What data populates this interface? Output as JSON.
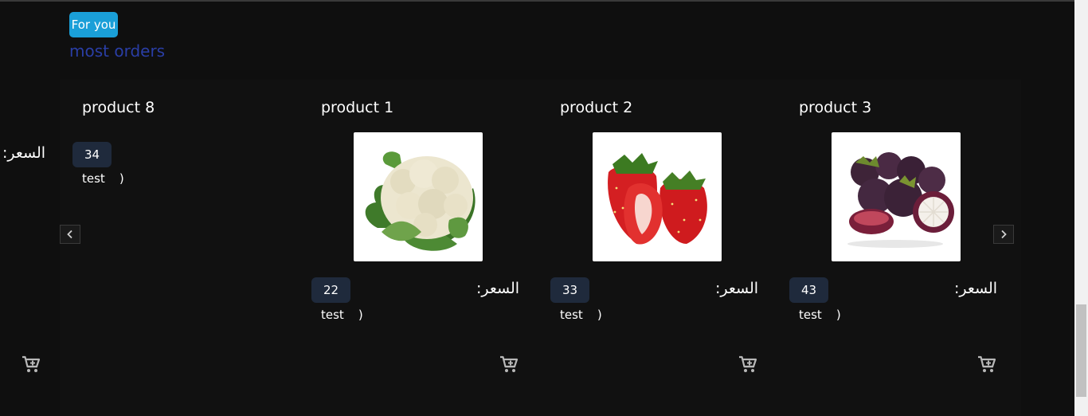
{
  "header": {
    "badge_label": "For you",
    "section_title": "most orders"
  },
  "products": [
    {
      "title": "product 8",
      "price_label": "السعر:",
      "price": "34",
      "desc": "test",
      "paren": ")",
      "image": "none"
    },
    {
      "title": "product 1",
      "price_label": "السعر:",
      "price": "22",
      "desc": "test",
      "paren": ")",
      "image": "cauliflower"
    },
    {
      "title": "product 2",
      "price_label": "السعر:",
      "price": "33",
      "desc": "test",
      "paren": ")",
      "image": "strawberries"
    },
    {
      "title": "product 3",
      "price_label": "السعر:",
      "price": "43",
      "desc": "test",
      "paren": ")",
      "image": "mangosteen"
    }
  ],
  "icons": {
    "prev": "chevron-left-icon",
    "next": "chevron-right-icon",
    "cart": "cart-plus-icon"
  },
  "colors": {
    "badge": "#1a9fd8",
    "section_title": "#2a3ea6",
    "price_badge": "#1f2a3c",
    "background": "#0f0f0f"
  }
}
